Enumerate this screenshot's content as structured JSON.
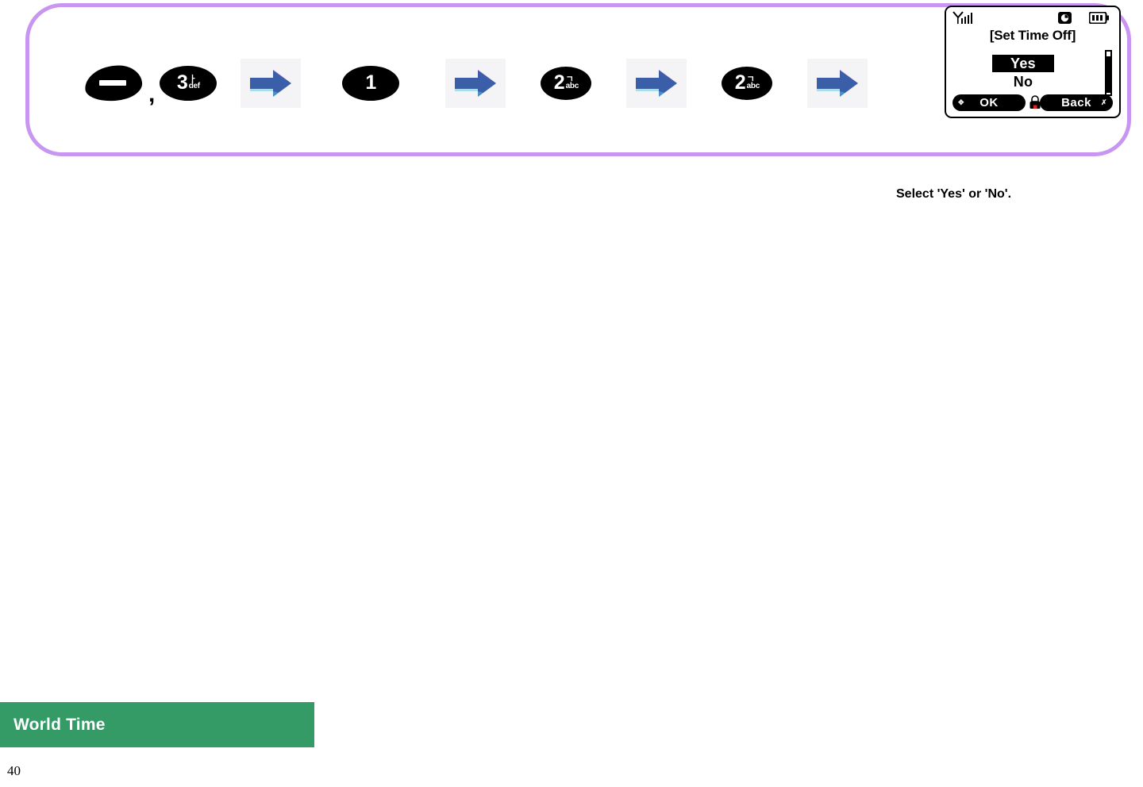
{
  "steps_panel": {
    "border_color": "#c896f0",
    "sequence": [
      {
        "type": "menu-key",
        "icon": "menu-key-icon",
        "label": ""
      },
      {
        "type": "separator",
        "label": ","
      },
      {
        "type": "number-key",
        "digit": "3",
        "hangul": "ㅏ",
        "latin": "def"
      },
      {
        "type": "arrow",
        "icon": "right-arrow-icon"
      },
      {
        "type": "number-key",
        "digit": "1",
        "hangul": "",
        "latin": ""
      },
      {
        "type": "arrow",
        "icon": "right-arrow-icon"
      },
      {
        "type": "number-key",
        "digit": "2",
        "hangul": "ㄱ",
        "latin": "abc"
      },
      {
        "type": "arrow",
        "icon": "right-arrow-icon"
      },
      {
        "type": "number-key",
        "digit": "2",
        "hangul": "ㄱ",
        "latin": "abc"
      },
      {
        "type": "arrow",
        "icon": "right-arrow-icon"
      }
    ],
    "keys": {
      "key1_digit": "3",
      "key1_hangul": "ㅏ",
      "key1_latin": "def",
      "key2_digit": "1",
      "key3_digit": "2",
      "key3_hangul": "ㄱ",
      "key3_latin": "abc",
      "key4_digit": "2",
      "key4_hangul": "ㄱ",
      "key4_latin": "abc",
      "comma": ","
    },
    "arrow_color": "#3a5fa8"
  },
  "phone_screen": {
    "status_bar": {
      "signal_icon": "signal-bars-icon",
      "clock_icon": "alarm-clock-icon",
      "battery_icon": "battery-icon"
    },
    "title": "[Set Time Off]",
    "options": [
      {
        "label": "Yes",
        "selected": true
      },
      {
        "label": "No",
        "selected": false
      }
    ],
    "option_yes": "Yes",
    "option_no": "No",
    "softkeys": {
      "left_label": "OK",
      "right_label": "Back",
      "center_icon": "basket-icon"
    },
    "scrollbar": {
      "present": true
    }
  },
  "caption": "Select 'Yes' or 'No'.",
  "footer": {
    "banner_label": "World Time",
    "banner_color": "#349a66",
    "page_number": "40"
  }
}
